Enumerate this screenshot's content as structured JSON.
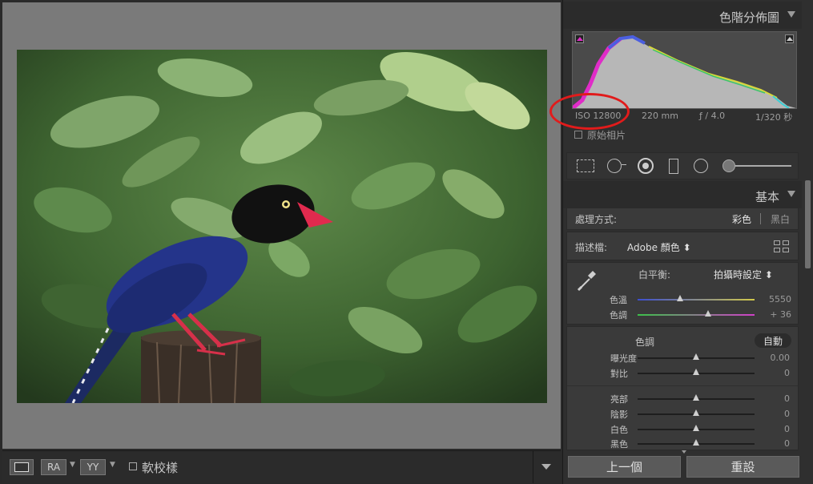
{
  "left": {
    "toolbar": {
      "ra_label": "RA",
      "yy_label": "YY",
      "soft_proof_label": "軟校樣"
    }
  },
  "histogram": {
    "title": "色階分佈圖",
    "iso": "ISO 12800",
    "focal": "220 mm",
    "aperture": "ƒ / 4.0",
    "shutter": "1/320 秒",
    "original_photo_label": "原始相片"
  },
  "basic": {
    "title": "基本",
    "treatment_label": "處理方式:",
    "color_label": "彩色",
    "bw_label": "黑白",
    "profile_label": "描述檔:",
    "profile_value": "Adobe 顏色 ⬍",
    "wb_label": "白平衡:",
    "wb_value": "拍攝時設定 ⬍",
    "temp_label": "色溫",
    "temp_value": "5550",
    "tint_label": "色調",
    "tint_value": "+ 36",
    "tone_label": "色調",
    "auto_label": "自動",
    "exposure_label": "曝光度",
    "exposure_value": "0.00",
    "contrast_label": "對比",
    "contrast_value": "0",
    "highlights_label": "亮部",
    "highlights_value": "0",
    "shadows_label": "陰影",
    "shadows_value": "0",
    "whites_label": "白色",
    "whites_value": "0",
    "blacks_label": "黑色",
    "blacks_value": "0"
  },
  "buttons": {
    "previous": "上一個",
    "reset": "重設"
  },
  "colors": {
    "annotation_red": "#e11b1b",
    "panel_bg": "#3a3a3a"
  }
}
